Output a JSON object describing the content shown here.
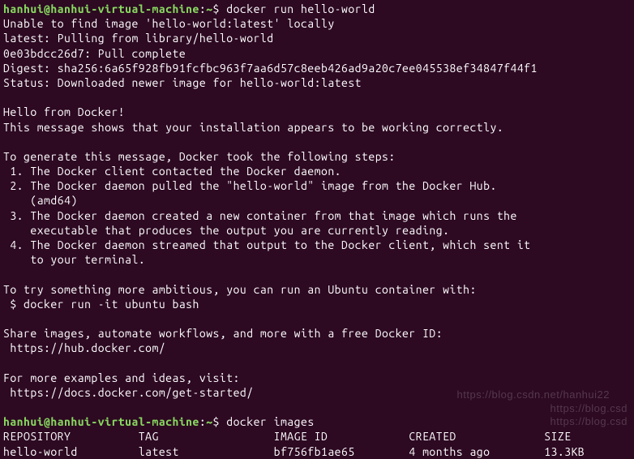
{
  "prompt1": {
    "user_host": "hanhui@hanhui-virtual-machine",
    "separator": ":",
    "path": "~",
    "symbol": "$",
    "command": "docker run hello-world"
  },
  "output1": [
    "Unable to find image 'hello-world:latest' locally",
    "latest: Pulling from library/hello-world",
    "0e03bdcc26d7: Pull complete",
    "Digest: sha256:6a65f928fb91fcfbc963f7aa6d57c8eeb426ad9a20c7ee045538ef34847f44f1",
    "Status: Downloaded newer image for hello-world:latest",
    "",
    "Hello from Docker!",
    "This message shows that your installation appears to be working correctly.",
    "",
    "To generate this message, Docker took the following steps:",
    " 1. The Docker client contacted the Docker daemon.",
    " 2. The Docker daemon pulled the \"hello-world\" image from the Docker Hub.",
    "    (amd64)",
    " 3. The Docker daemon created a new container from that image which runs the",
    "    executable that produces the output you are currently reading.",
    " 4. The Docker daemon streamed that output to the Docker client, which sent it",
    "    to your terminal.",
    "",
    "To try something more ambitious, you can run an Ubuntu container with:",
    " $ docker run -it ubuntu bash",
    "",
    "Share images, automate workflows, and more with a free Docker ID:",
    " https://hub.docker.com/",
    "",
    "For more examples and ideas, visit:",
    " https://docs.docker.com/get-started/",
    ""
  ],
  "prompt2": {
    "user_host": "hanhui@hanhui-virtual-machine",
    "separator": ":",
    "path": "~",
    "symbol": "$",
    "command": "docker images"
  },
  "table": {
    "header": "REPOSITORY          TAG                 IMAGE ID            CREATED             SIZE",
    "row1": "hello-world         latest              bf756fb1ae65        4 months ago        13.3KB"
  },
  "watermarks": {
    "w1": "https://blog.csdn.net/hanhui22",
    "w2": "https://blog.csd",
    "w3": "https://blog.csd"
  }
}
